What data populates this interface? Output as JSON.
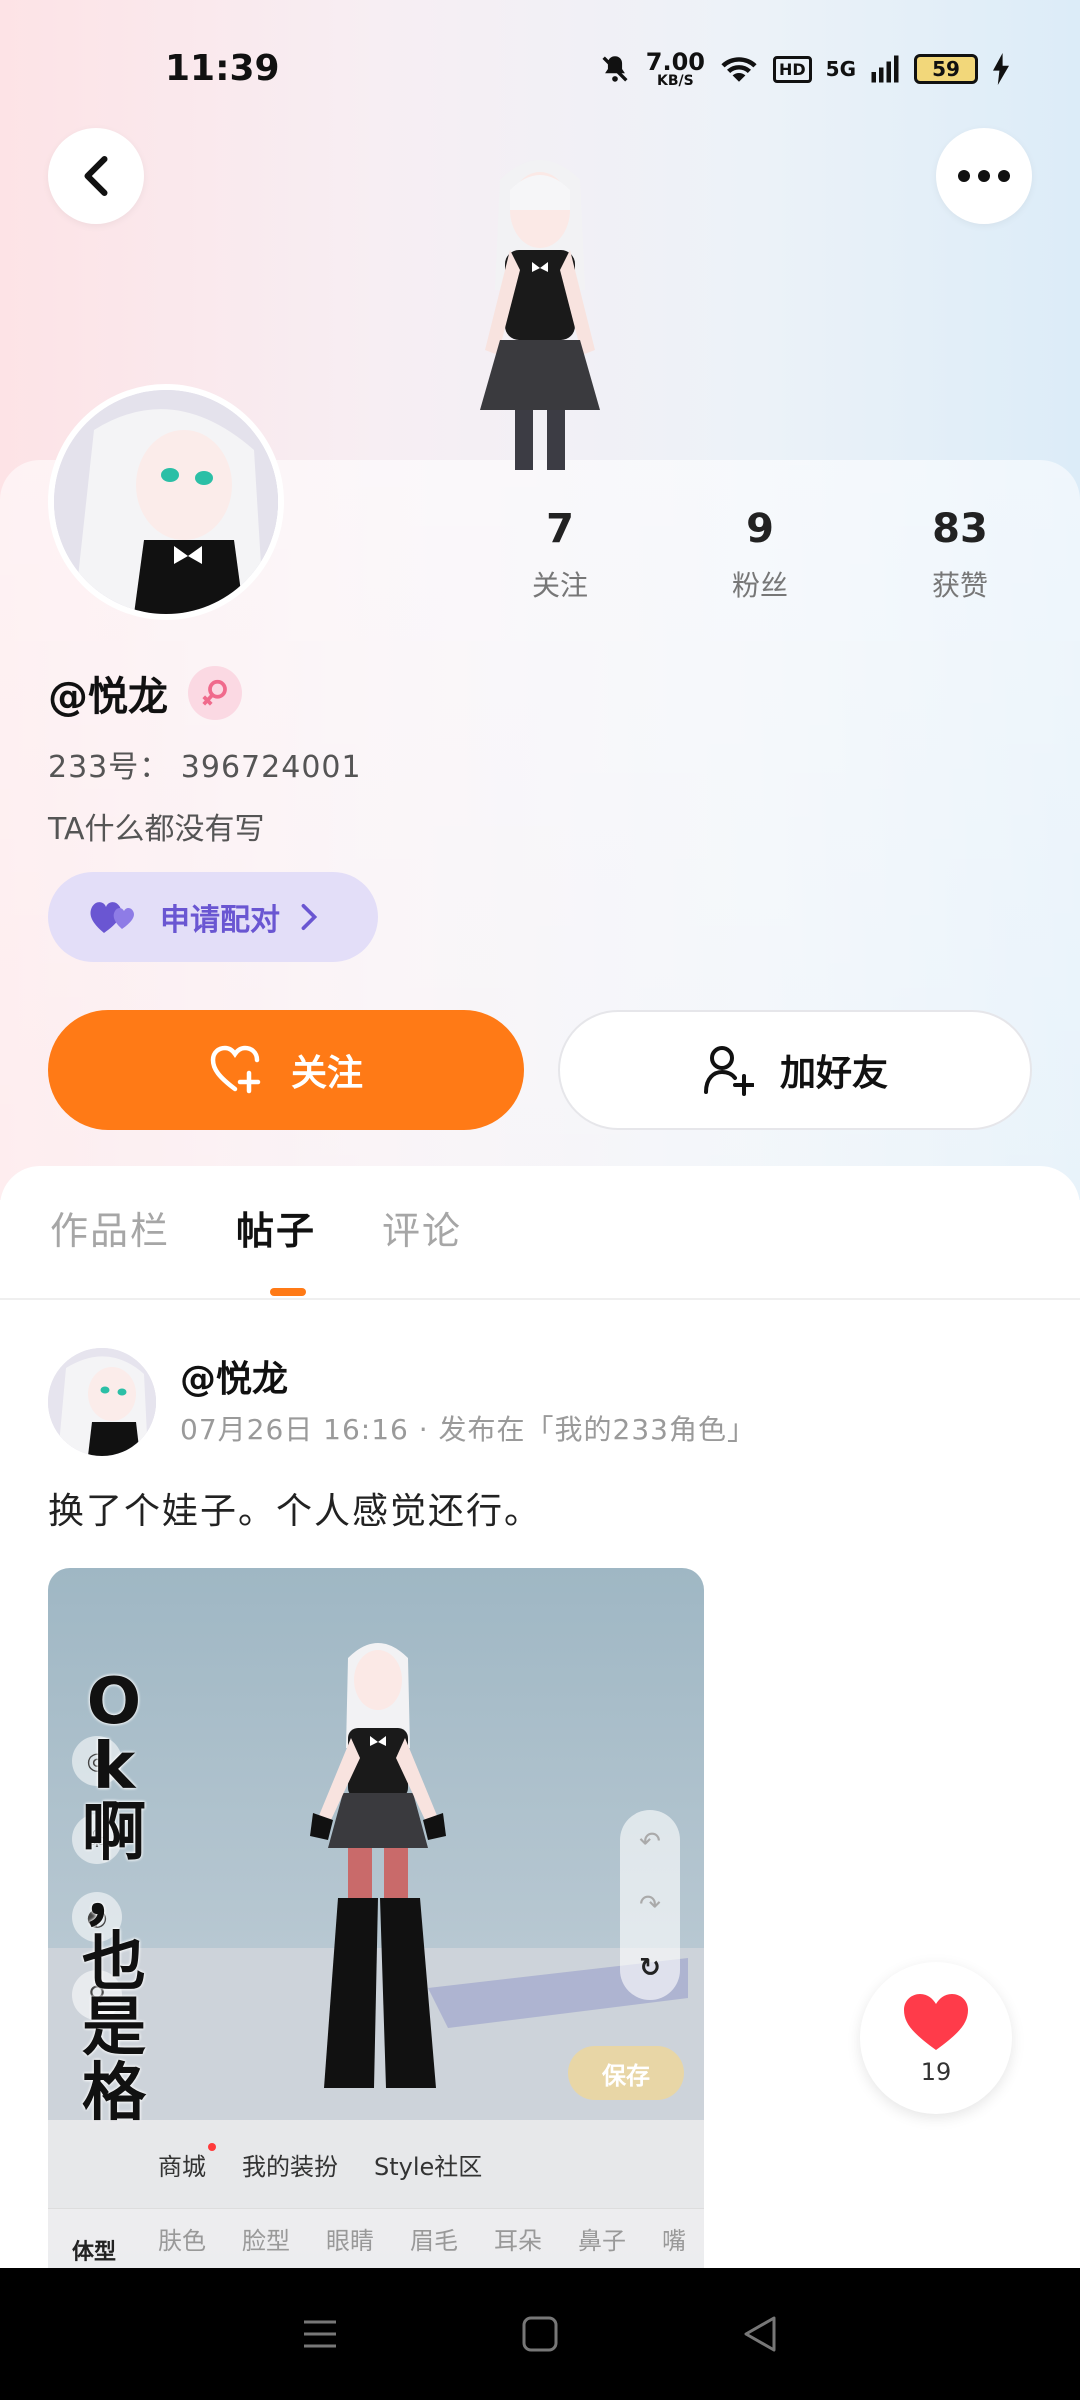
{
  "status_bar": {
    "time": "11:39",
    "net_speed_value": "7.00",
    "net_speed_unit": "KB/S",
    "hd": "HD",
    "network": "5G",
    "battery": "59"
  },
  "header": {
    "back_icon": "chevron-left-icon",
    "more_icon": "more-dots-icon"
  },
  "profile": {
    "username": "@悦龙",
    "uid": "233号：  396724001",
    "bio": "TA什么都没有写",
    "gender_icon": "female-icon",
    "stats": [
      {
        "value": "7",
        "label": "关注"
      },
      {
        "value": "9",
        "label": "粉丝"
      },
      {
        "value": "83",
        "label": "获赞"
      }
    ]
  },
  "actions": {
    "pair_label": "申请配对",
    "follow_label": "关注",
    "add_friend_label": "加好友"
  },
  "tabs": [
    {
      "label": "作品栏",
      "active": false
    },
    {
      "label": "帖子",
      "active": true
    },
    {
      "label": "评论",
      "active": false
    }
  ],
  "post": {
    "author": "@悦龙",
    "meta": "07月26日  16:16 · 发布在「我的233角色」",
    "text": "换了个娃子。个人感觉还行。",
    "image": {
      "overlay_text": "O k 啊 ， 也 是 格",
      "save_label": "保存",
      "bottom_tabs": [
        "商城",
        "我的装扮",
        "Style社区"
      ],
      "bottom_sub": [
        "肤色",
        "脸型",
        "眼睛",
        "眉毛",
        "耳朵",
        "鼻子",
        "嘴"
      ],
      "left_small": "体型"
    }
  },
  "like": {
    "count": "19",
    "color": "#ff3b4a"
  },
  "colors": {
    "accent": "#ff7a16",
    "pair_bg": "#e3def8",
    "pair_fg": "#6a56d2"
  }
}
